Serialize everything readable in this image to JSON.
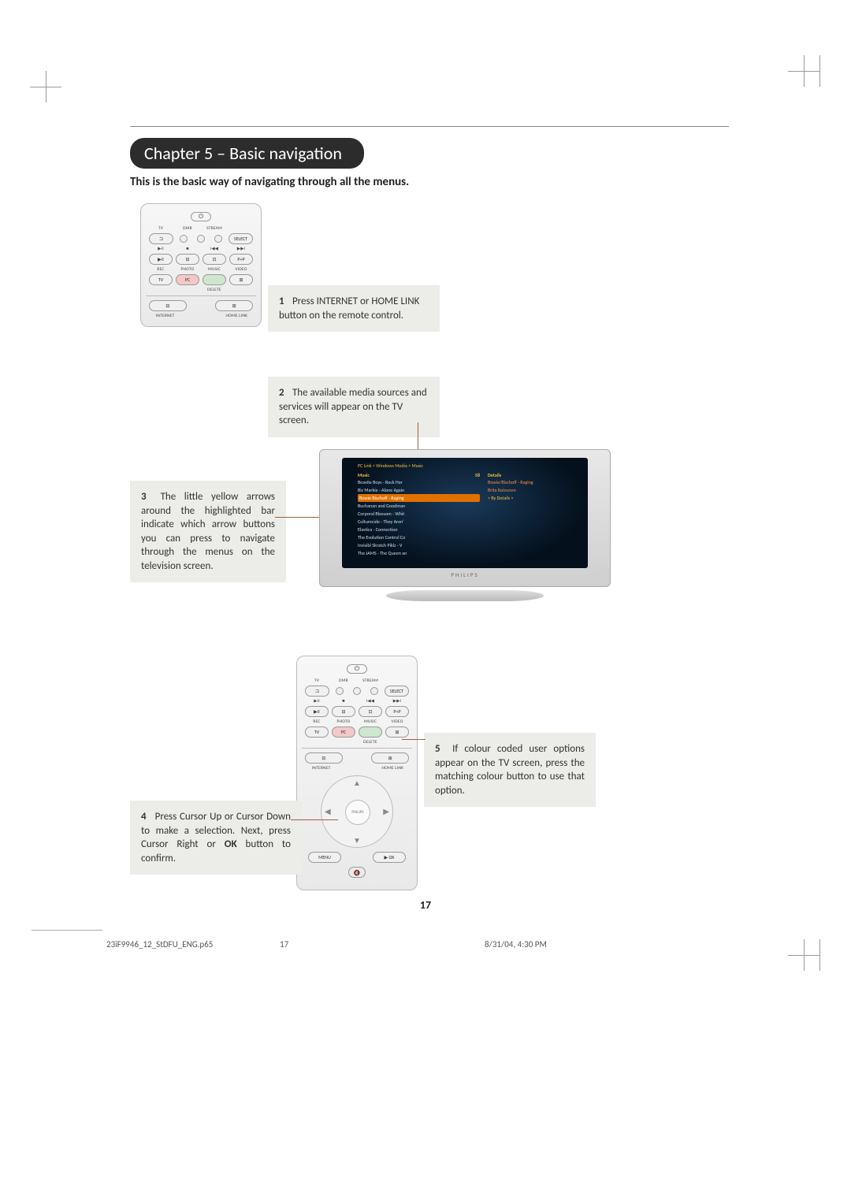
{
  "chapter_title": "Chapter 5 – Basic navigation",
  "intro": "This is the basic way of navigating through all the menus.",
  "steps": {
    "s1": {
      "num": "1",
      "text": "Press INTERNET or HOME LINK button on the remote control."
    },
    "s2": {
      "num": "2",
      "text": "The available media sources and services will appear on the TV screen."
    },
    "s3": {
      "num": "3",
      "text": "The little yellow arrows around the highlighted bar indicate which arrow buttons you can press to navigate through the menus on the television screen."
    },
    "s4": {
      "num": "4",
      "text_a": "Press Cursor Up or Cursor Down to make a selection. Next, press Cursor Right or ",
      "strong": "OK",
      "text_b": " button to confirm."
    },
    "s5": {
      "num": "5",
      "text": "If colour coded user options appear on the TV screen, press the matching colour button to use that option."
    }
  },
  "remote": {
    "labels": {
      "tv": "TV",
      "dmr": "DMR",
      "stream": "STREAM",
      "select": "SELECT",
      "playpause": "▶II",
      "stop": "■",
      "prev": "I◀◀",
      "next": "▶▶I",
      "rec": "REC",
      "photo": "PHOTO",
      "music": "MUSIC",
      "video": "VIDEO",
      "tvbtn": "TV",
      "pc": "PC",
      "delete": "DELETE",
      "internet": "INTERNET",
      "homelink": "HOME LINK",
      "menu": "MENU",
      "ok": "▶ OK",
      "brand": "PHILIPS",
      "pip": "P+P",
      "ext": "⊐",
      "subtitle": "⊟",
      "guide": "⊡",
      "mute": "🔇"
    }
  },
  "tv_menu": {
    "breadcrumb": "PC Link > Windows Media > Music",
    "left_header": "Music",
    "left_count": "58",
    "right_header": "Details",
    "right_sub1": "Bowie/Bischoff - Raging",
    "right_sub2": "Brita Koivunen",
    "right_link": "> By Details >",
    "items": [
      "Beastie Boys - Rock Har",
      "Biz Markie - Alone Again",
      "Bowie Bischoff - Raging",
      "Buchanan and Goodman",
      "Corporal Blossom - Whit",
      "Culturecide - They Aren'",
      "Elastica - Connection",
      "The Evolution Control Co",
      "Invisibl Skratch Piklz - V",
      "The JAMS - The Queen an"
    ],
    "highlight_index": 2,
    "brand": "PHILIPS"
  },
  "page_number": "17",
  "footer": {
    "file": "23iF9946_12_StDFU_ENG.p65",
    "page": "17",
    "timestamp": "8/31/04, 4:30 PM"
  }
}
